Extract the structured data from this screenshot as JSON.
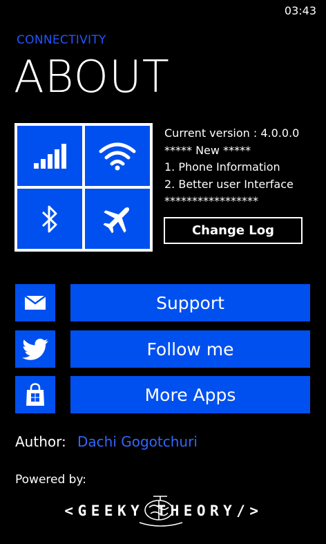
{
  "status_bar": {
    "time": "03:43"
  },
  "header": {
    "app_label": "CONNECTIVITY",
    "title": "ABOUT"
  },
  "tiles": [
    {
      "icon": "signal-bars-icon"
    },
    {
      "icon": "wifi-icon"
    },
    {
      "icon": "bluetooth-icon"
    },
    {
      "icon": "airplane-icon"
    }
  ],
  "info": {
    "version_line": "Current version :  4.0.0.0",
    "new_header": "***** New *****",
    "item_1": "1.  Phone Information",
    "item_2": "2.  Better user Interface",
    "stars_line": "*****************"
  },
  "changelog": {
    "label": "Change Log"
  },
  "actions": [
    {
      "icon": "mail-icon",
      "label": "Support"
    },
    {
      "icon": "twitter-bird-icon",
      "label": "Follow me"
    },
    {
      "icon": "store-bag-icon",
      "label": "More Apps"
    }
  ],
  "author": {
    "label": "Author:",
    "name": "Dachi Gogotchuri"
  },
  "powered": {
    "label": "Powered by:",
    "logo_text": "<GEEKY THEORY/>"
  },
  "colors": {
    "accent": "#0050ef",
    "link": "#3366ff",
    "background": "#000000"
  }
}
